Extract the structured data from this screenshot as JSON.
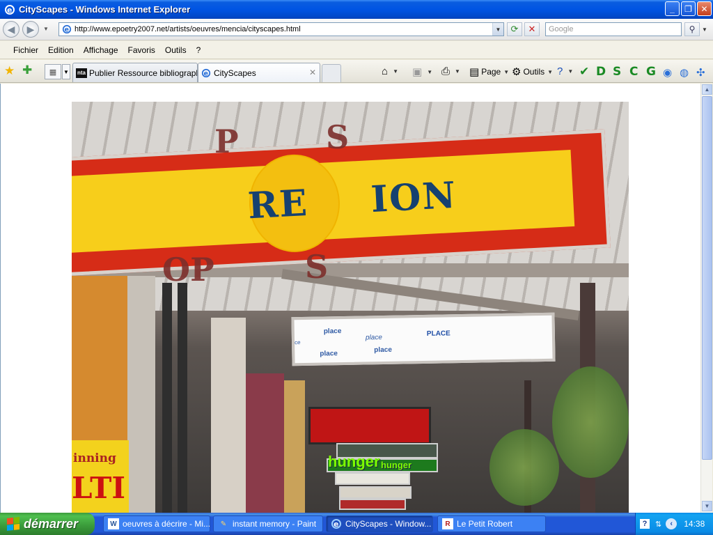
{
  "window": {
    "title": "CityScapes - Windows Internet Explorer",
    "minimize": "_",
    "maximize": "❐",
    "close": "✕"
  },
  "address": {
    "url": "http://www.epoetry2007.net/artists/oeuvres/mencia/cityscapes.html",
    "search_placeholder": "Google"
  },
  "menu": {
    "items": [
      "Fichier",
      "Edition",
      "Affichage",
      "Favoris",
      "Outils",
      "?"
    ]
  },
  "tabs": [
    {
      "label": "Publier Ressource bibliograph...",
      "favicon": "nta",
      "active": false
    },
    {
      "label": "CityScapes",
      "favicon": "ie",
      "active": true
    }
  ],
  "commands": {
    "page": "Page",
    "tools": "Outils"
  },
  "toolbar_letters": [
    "D",
    "S",
    "C",
    "G"
  ],
  "artwork": {
    "word_left": "RE",
    "word_right": "ION",
    "letters": [
      "P",
      "S",
      "OP",
      "S"
    ],
    "place_words": [
      "place",
      "place",
      "PLACE",
      "place",
      "place",
      "ce"
    ],
    "hunger_big": "hunger",
    "hunger_small": "hunger",
    "poster_top": "inning",
    "poster_bottom": "LTI"
  },
  "taskbar": {
    "start_label": "démarrer",
    "tasks": [
      {
        "label": "oeuvres à décrire - Mi...",
        "icon": "word-icon",
        "active": false
      },
      {
        "label": "instant memory - Paint",
        "icon": "paint-icon",
        "active": false
      },
      {
        "label": "CityScapes - Window...",
        "icon": "ie-icon",
        "active": true
      },
      {
        "label": "Le Petit Robert",
        "icon": "robert-icon",
        "active": false
      }
    ],
    "clock": "14:38"
  }
}
